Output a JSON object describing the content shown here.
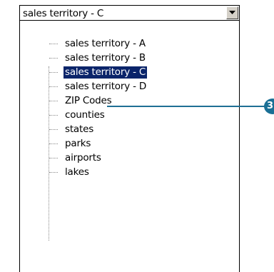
{
  "combo": {
    "selected_value": "sales territory - C",
    "button_icon": "chevron-down-icon"
  },
  "list": {
    "items": [
      {
        "label": "sales territory - A"
      },
      {
        "label": "sales territory - B"
      },
      {
        "label": "sales territory - C",
        "selected": true
      },
      {
        "label": "sales territory - D"
      },
      {
        "label": "ZIP Codes"
      },
      {
        "label": "counties"
      },
      {
        "label": "states"
      },
      {
        "label": "parks"
      },
      {
        "label": "airports"
      },
      {
        "label": "lakes"
      }
    ]
  },
  "callout": {
    "number": "3",
    "color": "#1a6f95"
  },
  "colors": {
    "selection_background": "#0a246a",
    "button_face": "#d4d0c8"
  }
}
